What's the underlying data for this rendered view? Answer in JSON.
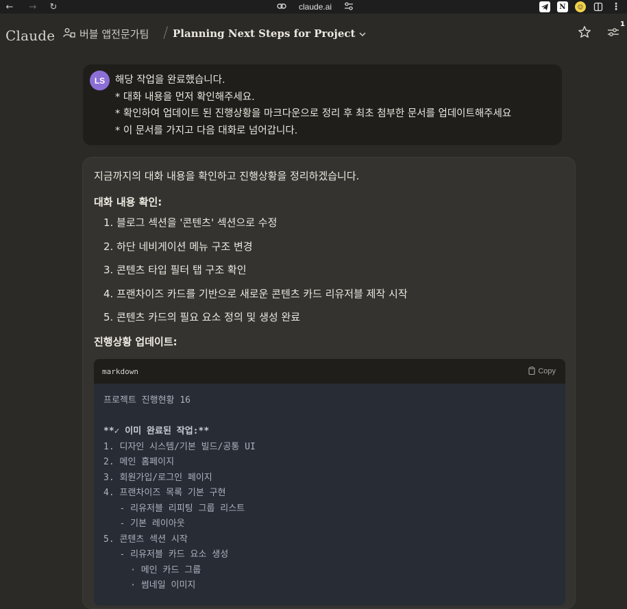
{
  "browser": {
    "url": "claude.ai",
    "back_glyph": "←",
    "forward_glyph": "→",
    "reload_glyph": "↻"
  },
  "header": {
    "logo": "Claude",
    "project_name": "버블 앱전문가팀",
    "chat_title": "Planning Next Steps for Project",
    "notification_count": "1"
  },
  "user_message": {
    "avatar_initials": "LS",
    "lines": [
      "해당 작업을 완료했습니다.",
      "* 대화 내용을 먼저 확인해주세요.",
      "* 확인하여 업데이트 된 진행상황을 마크다운으로 정리 후 최초 첨부한 문서를 업데이트해주세요",
      "* 이 문서를 가지고 다음 대화로 넘어갑니다."
    ]
  },
  "assistant_message": {
    "intro": "지금까지의 대화 내용을 확인하고 진행상황을 정리하겠습니다.",
    "section1_title": "대화 내용 확인:",
    "items": [
      "1. 블로그 섹션을 '콘텐츠' 섹션으로 수정",
      "2. 하단 네비게이션 메뉴 구조 변경",
      "3. 콘텐츠 타입 필터 탭 구조 확인",
      "4. 프랜차이즈 카드를 기반으로 새로운 콘텐츠 카드 리유저블 제작 시작",
      "5. 콘텐츠 카드의 필요 요소 정의 및 생성 완료"
    ],
    "section2_title": "진행상황 업데이트:"
  },
  "code_block": {
    "language": "markdown",
    "copy_label": "Copy",
    "lines": [
      "프로젝트 진행현황 16",
      "",
      "**✓ 이미 완료된 작업:**",
      "1. 디자인 시스템/기본 빌드/공통 UI",
      "2. 메인 홈페이지",
      "3. 회원가입/로그인 페이지",
      "4. 프랜차이즈 목록 기본 구현",
      "   - 리유저블 리피팅 그룹 리스트",
      "   - 기본 레이아웃",
      "5. 콘텐츠 섹션 시작",
      "   - 리유저블 카드 요소 생성",
      "     · 메인 카드 그룹",
      "     · 썸네일 이미지"
    ]
  },
  "colors": {
    "background": "#2b2a27",
    "user_bubble": "#1f1e1b",
    "assistant_bubble": "#34332f",
    "avatar": "#8b6fd6",
    "code_bg": "#282c34"
  }
}
